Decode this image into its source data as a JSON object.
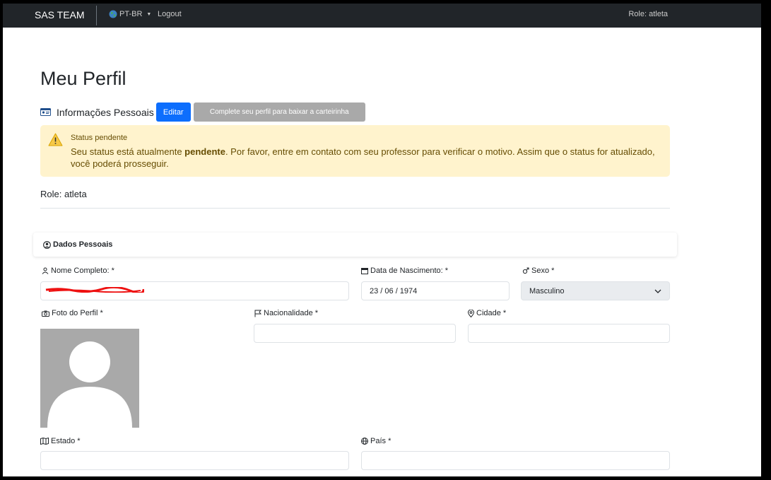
{
  "nav": {
    "brand": "SAS TEAM",
    "language": "PT-BR",
    "logout": "Logout",
    "role": "Role: atleta",
    "globe_icon": "globe-icon"
  },
  "page": {
    "title": "Meu Perfil",
    "info_title": "Informações Pessoais",
    "edit_button": "Editar",
    "card_button": "Complete seu perfil para baixar a carteirinha"
  },
  "alert": {
    "title": "Status pendente",
    "msg_before": "Seu status está atualmente ",
    "msg_bold": "pendente",
    "msg_after": ". Por favor, entre em contato com seu professor para verificar o motivo. Assim que o status for atualizado, você poderá prosseguir.",
    "bg_color": "#fff3cd",
    "text_color": "#664d03"
  },
  "role_line": "Role: atleta",
  "section": {
    "title": "Dados Pessoais"
  },
  "form": {
    "nome_label": "Nome Completo: *",
    "nome_value": "",
    "nascimento_label": "Data de Nascimento: *",
    "nascimento_value": "23 / 06 / 1974",
    "sexo_label": "Sexo *",
    "sexo_value": "Masculino",
    "foto_label": "Foto do Perfil *",
    "nacionalidade_label": "Nacionalidade *",
    "nacionalidade_value": "",
    "cidade_label": "Cidade *",
    "cidade_value": "",
    "estado_label": "Estado *",
    "estado_value": "",
    "pais_label": "País *",
    "pais_value": ""
  },
  "colors": {
    "navbar": "#212529",
    "primary": "#0d6efd",
    "disabled_button": "#a9a9a9"
  }
}
